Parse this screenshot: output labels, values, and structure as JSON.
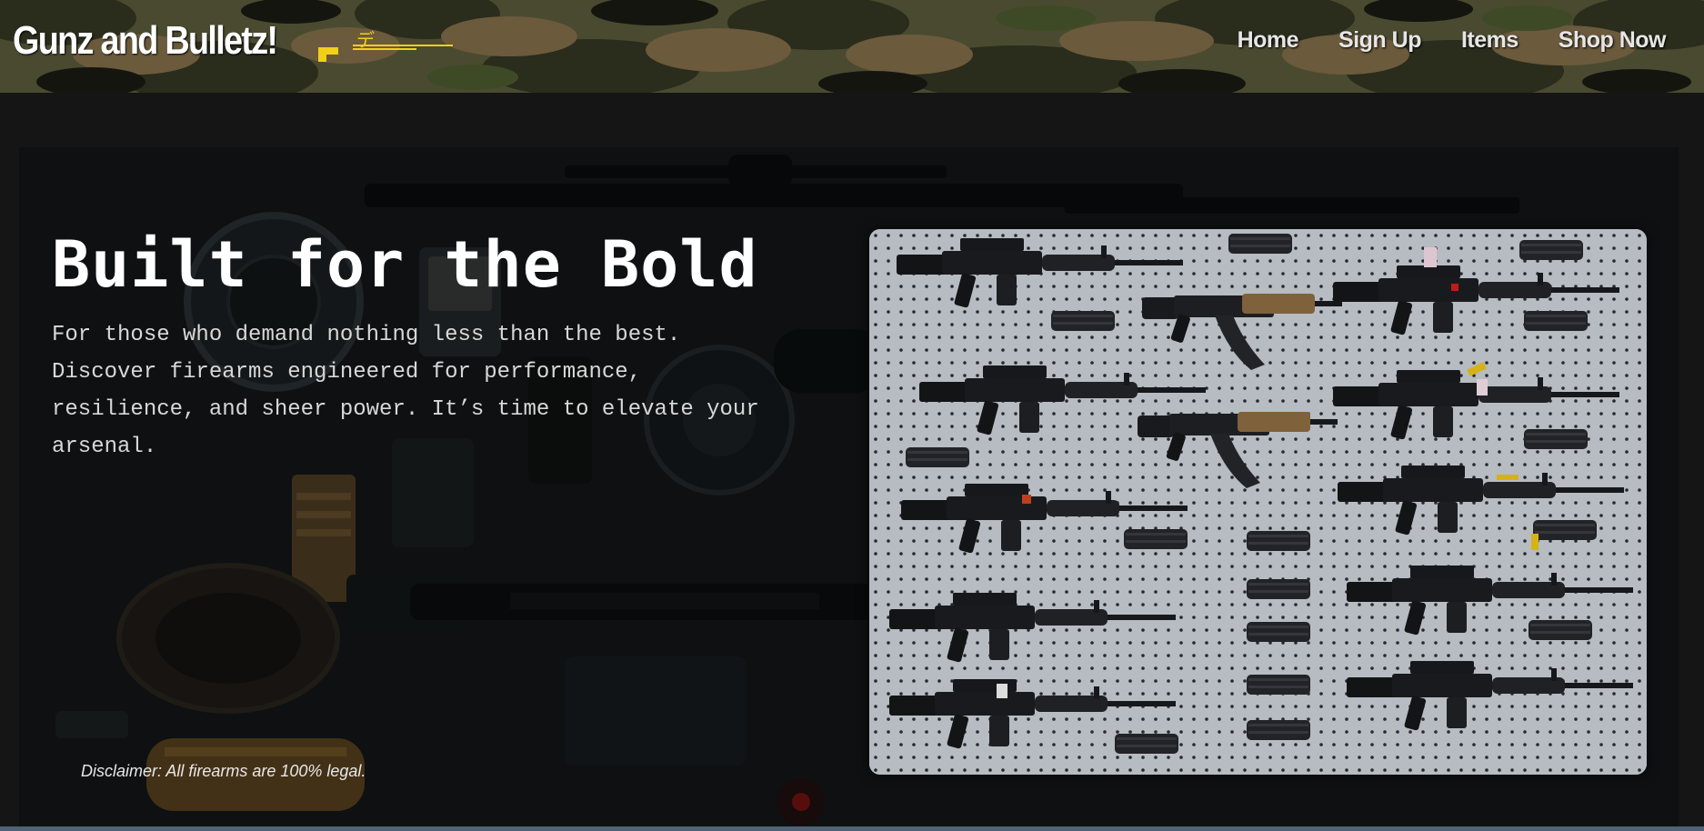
{
  "header": {
    "brand": "Gunz and Bulletz!",
    "logo_glyph": "デ",
    "logo_icon": "gun-icon",
    "accent": "#f2cf1a",
    "nav": [
      {
        "label": "Home"
      },
      {
        "label": "Sign Up"
      },
      {
        "label": "Items"
      },
      {
        "label": "Shop Now"
      }
    ]
  },
  "hero": {
    "title": "Built for the Bold",
    "description": "For those who demand nothing less than the best. Discover firearms engineered for performance, resilience, and sheer power. It’s time to elevate your arsenal.",
    "disclaimer": "Disclaimer: All firearms are 100% legal.",
    "image": "rifles-on-pegboard-photo",
    "background_image": "gear-flatlay-photo"
  }
}
